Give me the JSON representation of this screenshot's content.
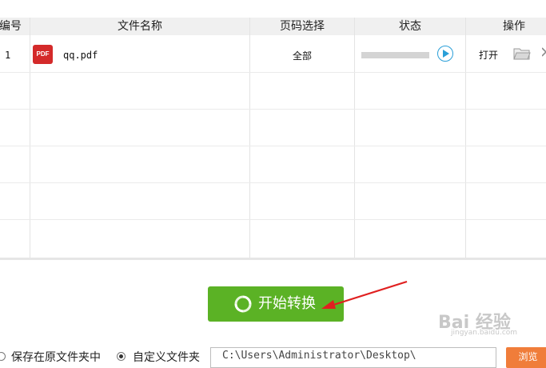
{
  "table": {
    "headers": [
      "编号",
      "文件名称",
      "页码选择",
      "状态",
      "操作"
    ],
    "rows": [
      {
        "index": "1",
        "file_icon_text": "PDF",
        "filename": "qq.pdf",
        "page_selection": "全部",
        "progress": 0,
        "open_label": "打开"
      }
    ]
  },
  "start_button": {
    "label": "开始转换"
  },
  "output": {
    "option_original": "保存在原文件夹中",
    "option_custom": "自定义文件夹",
    "selected": "custom",
    "path": "C:\\Users\\Administrator\\Desktop\\",
    "browse_label": "浏览"
  },
  "watermark": {
    "text": "Bai 经验",
    "sub": "jingyan.baidu.com"
  },
  "colors": {
    "accent_green": "#5bb225",
    "pdf_red": "#d42a2a",
    "play_blue": "#2a9fd8",
    "browse_orange": "#f07d3a",
    "arrow_red": "#e02020"
  },
  "icons": [
    "pdf-icon",
    "play-icon",
    "folder-icon",
    "refresh-icon",
    "arrow-annotation"
  ]
}
